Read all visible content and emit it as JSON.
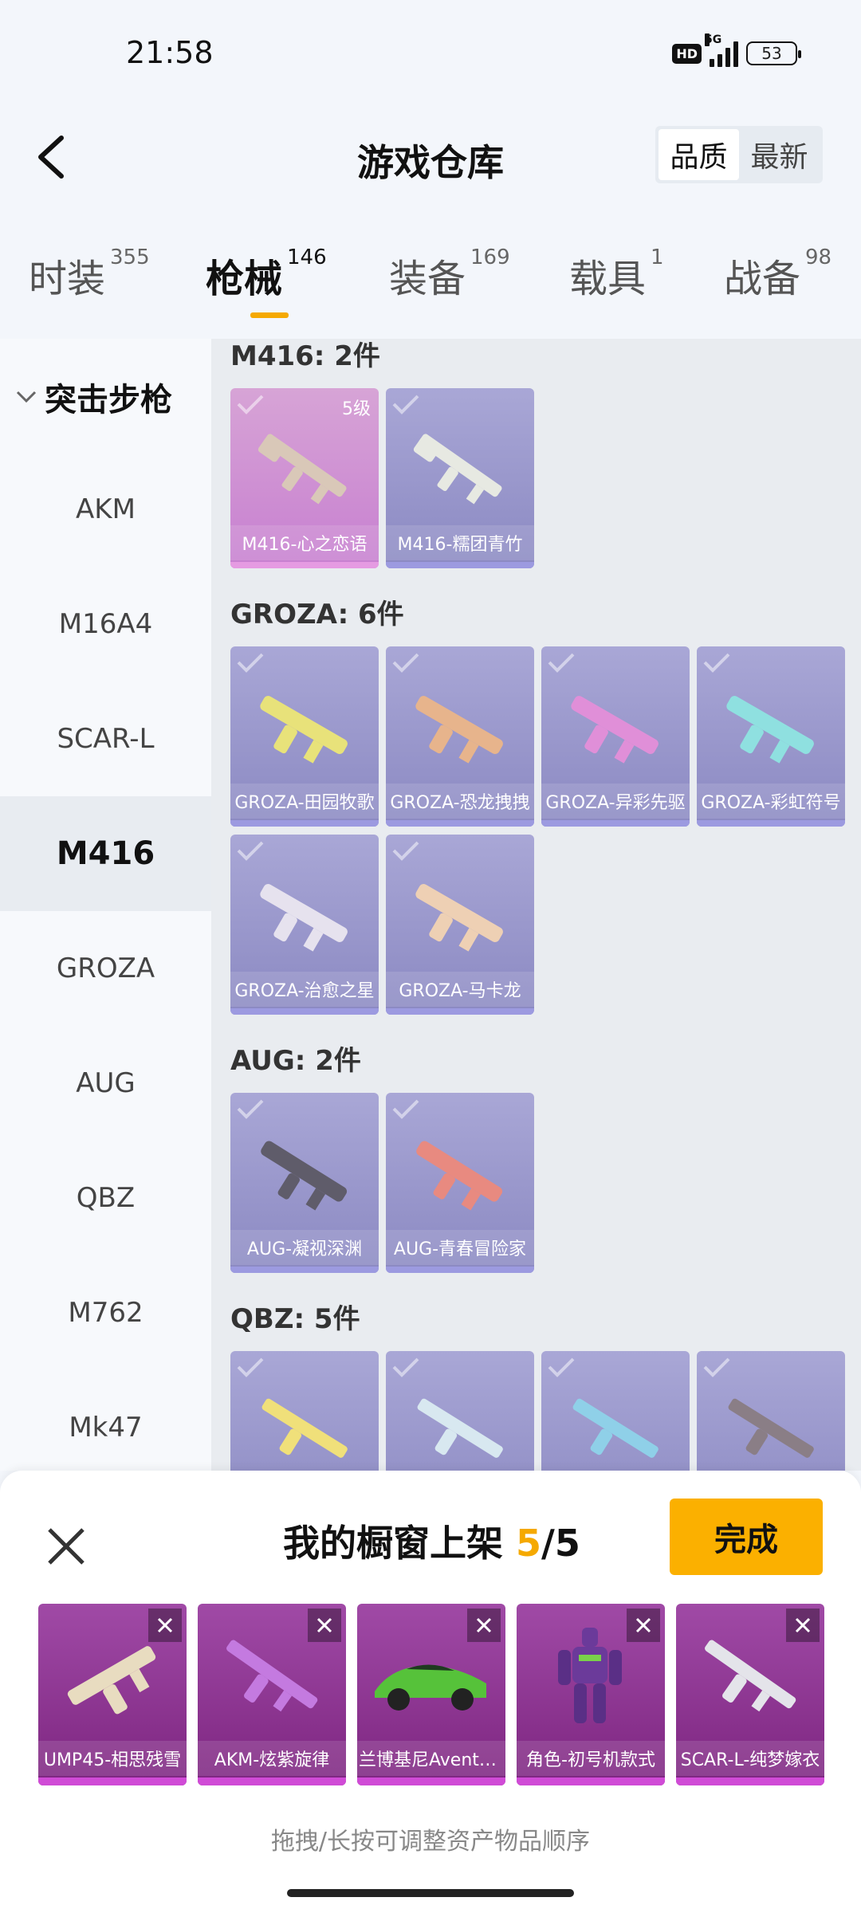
{
  "status": {
    "time": "21:58",
    "hd": "HD",
    "network": "5G",
    "battery": "53"
  },
  "header": {
    "title": "游戏仓库",
    "sort_options": [
      "品质",
      "最新"
    ],
    "active_sort": "品质"
  },
  "tabs": [
    {
      "label": "时装",
      "count": "355"
    },
    {
      "label": "枪械",
      "count": "146"
    },
    {
      "label": "装备",
      "count": "169"
    },
    {
      "label": "载具",
      "count": "1"
    },
    {
      "label": "战备",
      "count": "98"
    }
  ],
  "sidebar": {
    "category": "突击步枪",
    "items": [
      "AKM",
      "M16A4",
      "SCAR-L",
      "M416",
      "GROZA",
      "AUG",
      "QBZ",
      "M762",
      "Mk47"
    ],
    "active": "M416"
  },
  "groups": [
    {
      "title": "M416: 2件",
      "items": [
        {
          "label": "M416-心之恋语",
          "level": "5级",
          "color": "pink"
        },
        {
          "label": "M416-糯团青竹"
        }
      ]
    },
    {
      "title": "GROZA: 6件",
      "items": [
        {
          "label": "GROZA-田园牧歌"
        },
        {
          "label": "GROZA-恐龙拽拽"
        },
        {
          "label": "GROZA-异彩先驱"
        },
        {
          "label": "GROZA-彩虹符号"
        },
        {
          "label": "GROZA-治愈之星"
        },
        {
          "label": "GROZA-马卡龙"
        }
      ]
    },
    {
      "title": "AUG: 2件",
      "items": [
        {
          "label": "AUG-凝视深渊"
        },
        {
          "label": "AUG-青春冒险家"
        }
      ]
    },
    {
      "title": "QBZ: 5件",
      "items": [
        {
          "label": ""
        },
        {
          "label": ""
        },
        {
          "label": ""
        },
        {
          "label": ""
        }
      ]
    }
  ],
  "panel": {
    "title_prefix": "我的橱窗上架",
    "current": "5",
    "separator": "/",
    "total": "5",
    "done_label": "完成",
    "hint": "拖拽/长按可调整资产物品顺序",
    "items": [
      "UMP45-相思残雪",
      "AKM-炫紫旋律",
      "兰博基尼Aventador",
      "角色-初号机款式",
      "SCAR-L-纯梦嫁衣"
    ]
  },
  "colors": {
    "accent": "#f5a900",
    "card_purple": "#8b89c2",
    "card_pink": "#c77fd0",
    "showcase": "#7d2580"
  }
}
